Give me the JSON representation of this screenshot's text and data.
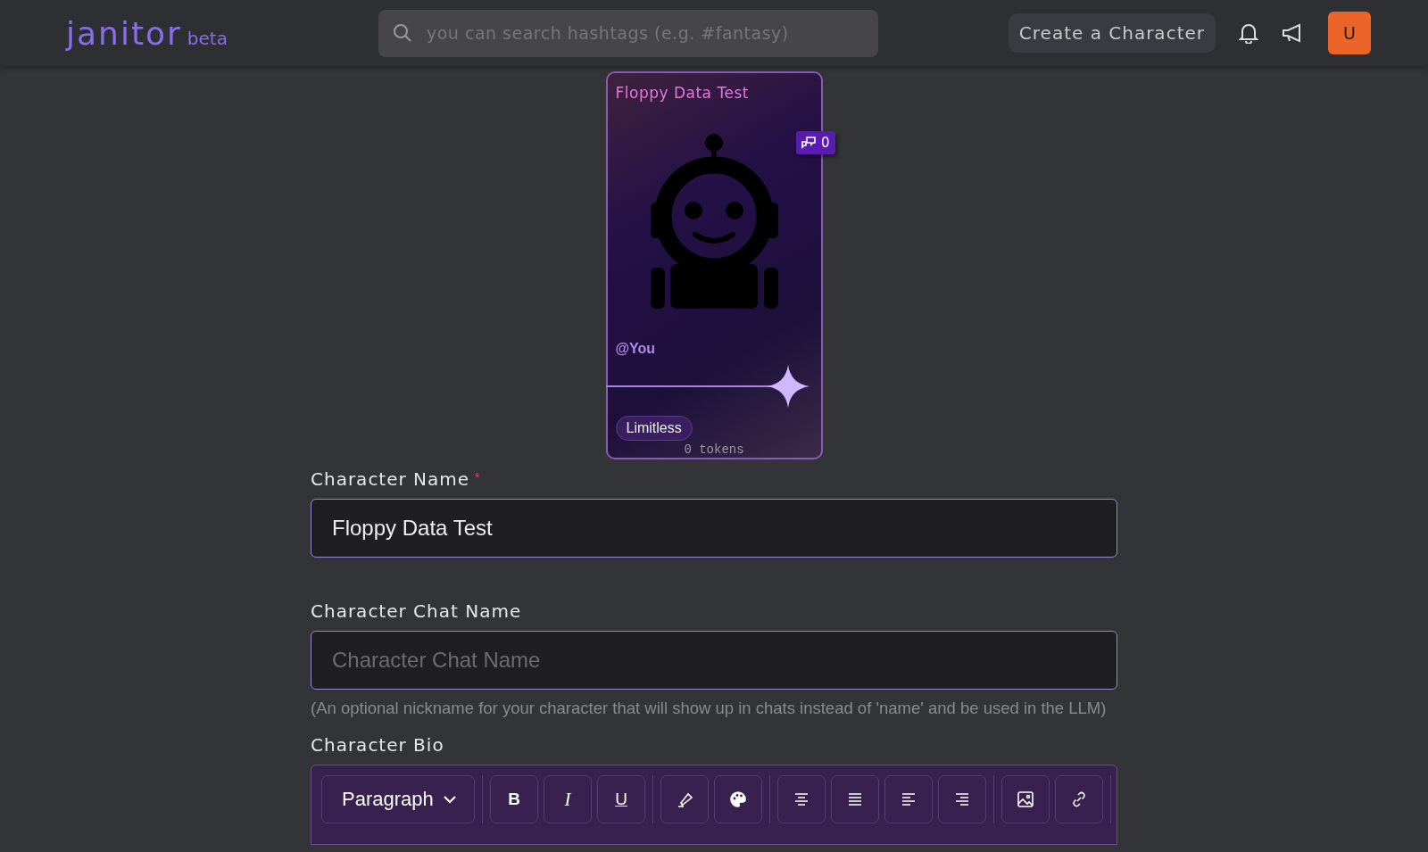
{
  "header": {
    "logo": "janitor",
    "logo_badge": "beta",
    "search": {
      "placeholder": "you can search hashtags (e.g. #fantasy)"
    },
    "create_button": "Create a Character",
    "avatar": "U"
  },
  "card": {
    "title": "Floppy Data Test",
    "chat_count": "0",
    "creator": "@You",
    "tag": "Limitless",
    "tokens": "0 tokens"
  },
  "fields": [
    {
      "label": "Character Name",
      "required_mark": "*",
      "value": "Floppy Data Test"
    },
    {
      "label": "Character Chat Name",
      "placeholder": "Character Chat Name",
      "hint": "(An optional nickname for your character that will show up in chats instead of 'name' and be used in the LLM)"
    }
  ],
  "bio": {
    "label": "Character Bio",
    "toolbar": {
      "format": "Paragraph",
      "text_buttons": [
        "B",
        "I",
        "U"
      ]
    }
  }
}
